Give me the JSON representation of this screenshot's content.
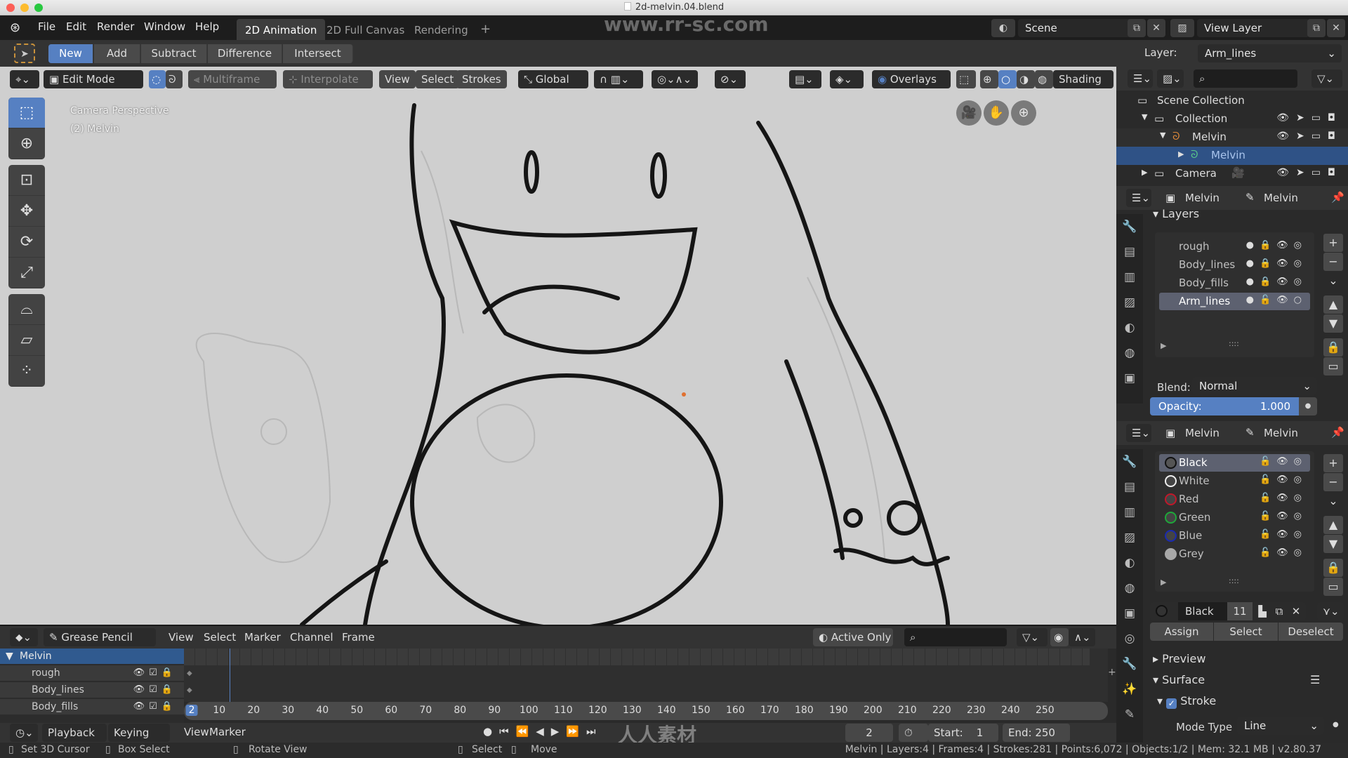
{
  "window": {
    "title": "2d-melvin.04.blend",
    "watermark_url": "www.rr-sc.com",
    "watermark_brand": "人人素材"
  },
  "menu": {
    "items": [
      "File",
      "Edit",
      "Render",
      "Window",
      "Help"
    ]
  },
  "workspaces": {
    "tabs": [
      "2D Animation",
      "2D Full Canvas",
      "Rendering"
    ],
    "active": "2D Animation",
    "add_label": "+"
  },
  "scene": {
    "label": "Scene"
  },
  "view_layer": {
    "label": "View Layer"
  },
  "tool_settings": {
    "modes": [
      "New",
      "Add",
      "Subtract",
      "Difference",
      "Intersect"
    ],
    "active_mode": "New",
    "layer_label": "Layer:",
    "layer_value": "Arm_lines"
  },
  "viewport_header": {
    "mode": "Edit Mode",
    "multiframe": "Multiframe",
    "interpolate": "Interpolate",
    "menus": [
      "View",
      "Select",
      "Strokes"
    ],
    "orientation": "Global",
    "overlays": "Overlays",
    "shading": "Shading"
  },
  "viewport": {
    "camera_label": "Camera Perspective",
    "object_label": "(2) Melvin"
  },
  "toolshelf": {
    "tools": [
      "select-box",
      "cursor",
      "transform",
      "move",
      "rotate",
      "scale",
      "bend",
      "shear",
      "to-sphere"
    ]
  },
  "outliner": {
    "rows": [
      {
        "label": "Scene Collection",
        "depth": 0
      },
      {
        "label": "Collection",
        "depth": 1
      },
      {
        "label": "Melvin",
        "depth": 2
      },
      {
        "label": "Melvin",
        "depth": 3,
        "selected": true
      },
      {
        "label": "Camera",
        "depth": 1
      }
    ]
  },
  "layers_panel": {
    "object_name": "Melvin",
    "data_name": "Melvin",
    "title": "Layers",
    "layers": [
      {
        "name": "rough",
        "locked": true
      },
      {
        "name": "Body_lines",
        "locked": true
      },
      {
        "name": "Body_fills",
        "locked": true
      },
      {
        "name": "Arm_lines",
        "locked": false,
        "active": true
      }
    ],
    "blend_label": "Blend:",
    "blend_value": "Normal",
    "opacity_label": "Opacity:",
    "opacity_value": "1.000"
  },
  "materials_panel": {
    "object_name": "Melvin",
    "data_name": "Melvin",
    "materials": [
      {
        "name": "Black",
        "color": "#111111",
        "active": true
      },
      {
        "name": "White",
        "color": "#eeeeee"
      },
      {
        "name": "Red",
        "color": "#c0182a"
      },
      {
        "name": "Green",
        "color": "#1ea83a"
      },
      {
        "name": "Blue",
        "color": "#1a2ab0"
      },
      {
        "name": "Grey",
        "color": "#a8a8a8"
      }
    ],
    "selected_name": "Black",
    "user_count": "11",
    "assign": "Assign",
    "select": "Select",
    "deselect": "Deselect",
    "preview": "Preview",
    "surface": "Surface",
    "stroke": "Stroke",
    "mode_type_label": "Mode Type",
    "mode_type_value": "Line"
  },
  "dopesheet": {
    "editor": "Grease Pencil",
    "menus": [
      "View",
      "Select",
      "Marker",
      "Channel",
      "Frame"
    ],
    "active_only": "Active Only",
    "channels": [
      {
        "name": "Melvin",
        "type": "object"
      },
      {
        "name": "rough"
      },
      {
        "name": "Body_lines"
      },
      {
        "name": "Body_fills"
      }
    ],
    "ticks": [
      "10",
      "20",
      "30",
      "40",
      "50",
      "60",
      "70",
      "80",
      "90",
      "100",
      "110",
      "120",
      "130",
      "140",
      "150",
      "160",
      "170",
      "180",
      "190",
      "200",
      "210",
      "220",
      "230",
      "240",
      "250"
    ],
    "current_frame": "2"
  },
  "timeline": {
    "menus": [
      "Playback",
      "Keying",
      "View",
      "Marker"
    ],
    "current_frame": "2",
    "start_label": "Start:",
    "start": "1",
    "end_label": "End:",
    "end": "250"
  },
  "statusbar": {
    "hints": [
      "Set 3D Cursor",
      "Box Select",
      "Rotate View",
      "Select",
      "Move"
    ],
    "stats": "Melvin | Layers:4 | Frames:4 | Strokes:281 | Points:6,072 | Objects:1/2 | Mem: 32.1 MB | v2.80.37"
  },
  "colors": {
    "accent": "#5680c2",
    "selection": "#2f5286"
  }
}
